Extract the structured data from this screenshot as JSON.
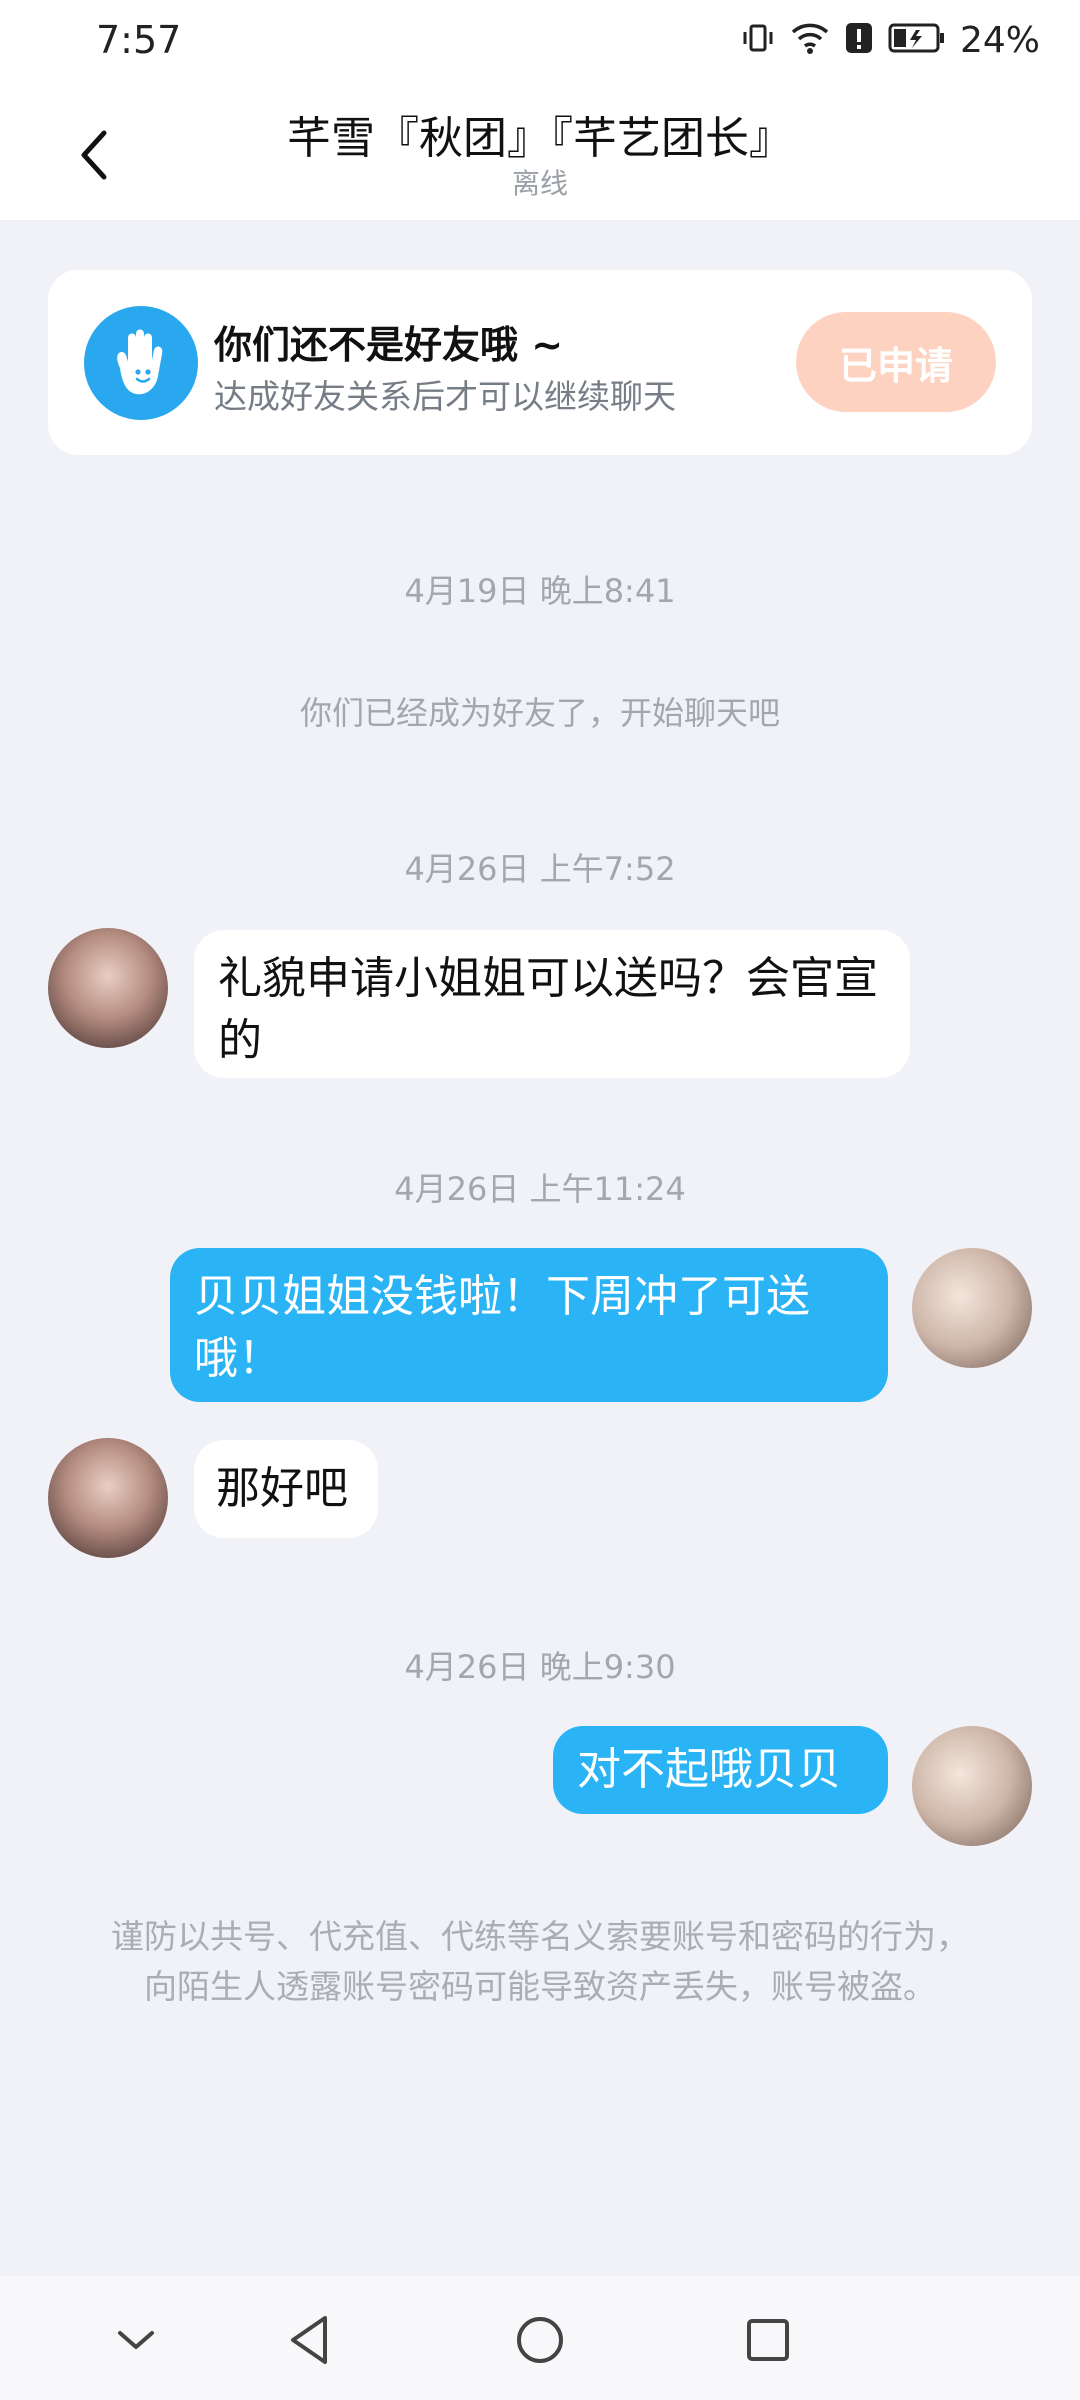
{
  "status_bar": {
    "time": "7:57",
    "battery": "24%",
    "icons": [
      "vibrate-icon",
      "wifi-icon",
      "alert-icon",
      "battery-icon"
    ]
  },
  "header": {
    "title": "芊雪『秋团』『芊艺团长』",
    "subtitle": "离线",
    "back_icon": "chevron-left-icon"
  },
  "friend_card": {
    "title": "你们还不是好友哦 ~",
    "description": "达成好友关系后才可以继续聊天",
    "button_label": "已申请",
    "icon": "hand-icon",
    "colors": {
      "icon_bg": "#29a8ef",
      "button_bg": "#fdd2c0"
    }
  },
  "messages": {
    "ts1": "4月19日 晚上8:41",
    "system": "你们已经成为好友了，开始聊天吧",
    "ts2": "4月26日 上午7:52",
    "msg1": "礼貌申请小姐姐可以送吗？会官宣的",
    "ts3": "4月26日 上午11:24",
    "msg2": "贝贝姐姐没钱啦！下周冲了可送哦！",
    "msg3": "那好吧",
    "ts4": "4月26日 晚上9:30",
    "msg4": "对不起哦贝贝"
  },
  "warning": "谨防以共号、代充值、代练等名义索要账号和密码的行为，向陌生人透露账号密码可能导致资产丢失，账号被盗。",
  "colors": {
    "outgoing_bubble": "#2ab4f5",
    "incoming_bubble": "#ffffff",
    "background": "#f1f2f8"
  },
  "nav_bar": {
    "icons": [
      "chevron-down-icon",
      "back-triangle-icon",
      "home-circle-icon",
      "recents-square-icon"
    ]
  }
}
